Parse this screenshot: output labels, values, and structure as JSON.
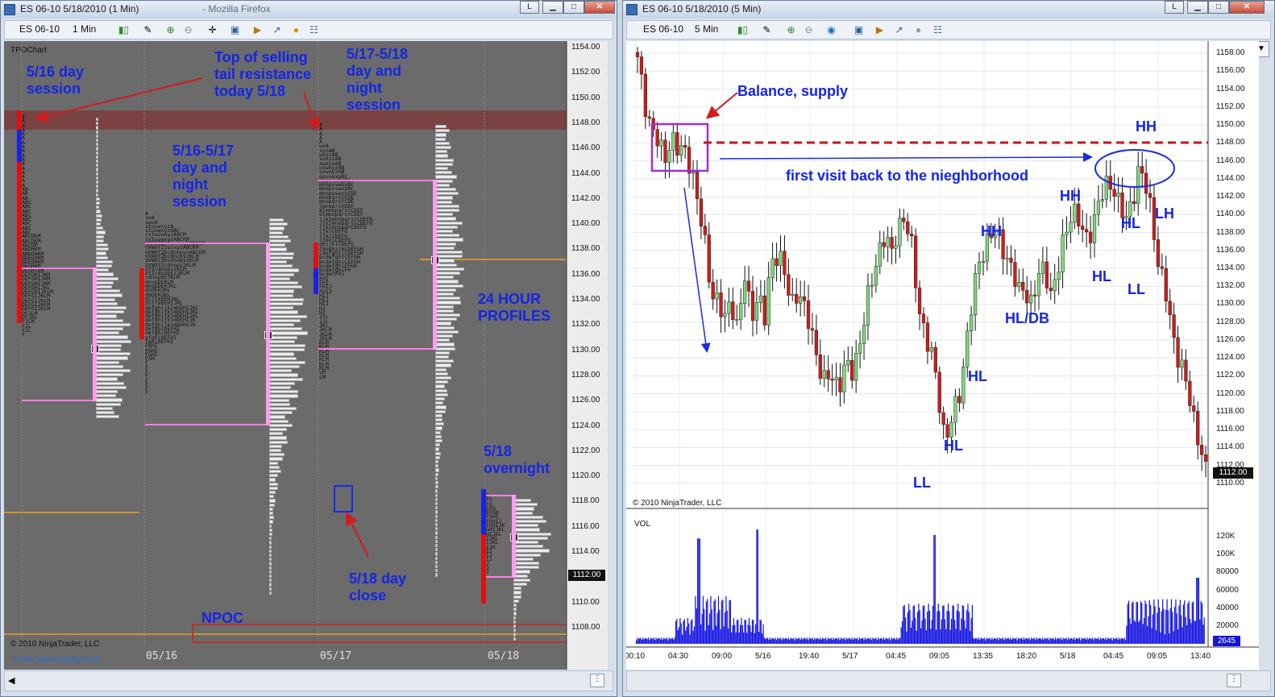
{
  "left_window": {
    "title": "ES 06-10  5/18/2010 (1 Min)",
    "title_suffix": "- Mozilla Firefox",
    "toolbar": {
      "instrument": "ES 06-10",
      "interval": "1 Min"
    },
    "chart_label": "TPOChart",
    "price_axis": [
      "1154.00",
      "1152.00",
      "1150.00",
      "1148.00",
      "1146.00",
      "1144.00",
      "1142.00",
      "1140.00",
      "1138.00",
      "1136.00",
      "1134.00",
      "1132.00",
      "1130.00",
      "1128.00",
      "1126.00",
      "1124.00",
      "1122.00",
      "1120.00",
      "1118.00",
      "1116.00",
      "1114.00",
      "1112.00",
      "1110.00",
      "1108.00"
    ],
    "current_price": "1112.00",
    "date_labels": [
      "05/16",
      "05/17",
      "05/18"
    ],
    "copyright": "© 2010 NinjaTrader, LLC",
    "watermark": "Email: www.tradegr.com",
    "annotations": {
      "day_session": "5/16 day\nsession",
      "selling_tail": "Top of selling\ntail resistance\ntoday 5/18",
      "session_517_518": "5/17-5/18\nday and\nnight\nsession",
      "session_516_517": "5/16-5/17\nday and\nnight\nsession",
      "profiles_24h": "24 HOUR\nPROFILES",
      "overnight": "5/18\novernight",
      "day_close": "5/18 day\nclose",
      "npoc": "NPOC"
    }
  },
  "right_window": {
    "title": "ES 06-10  5/18/2010 (5 Min)",
    "toolbar": {
      "instrument": "ES 06-10",
      "interval": "5 Min"
    },
    "price_axis": [
      "1158.00",
      "1156.00",
      "1154.00",
      "1152.00",
      "1150.00",
      "1148.00",
      "1146.00",
      "1144.00",
      "1142.00",
      "1140.00",
      "1138.00",
      "1136.00",
      "1134.00",
      "1132.00",
      "1130.00",
      "1128.00",
      "1126.00",
      "1124.00",
      "1122.00",
      "1120.00",
      "1118.00",
      "1116.00",
      "1114.00",
      "1112.00",
      "1110.00"
    ],
    "current_price": "1112.00",
    "copyright": "© 2010 NinjaTrader, LLC",
    "vol_label": "VOL",
    "vol_axis": [
      "120K",
      "100K",
      "80000",
      "60000",
      "40000",
      "20000"
    ],
    "vol_current": "2645",
    "time_labels": [
      "00:10",
      "04:30",
      "09:00",
      "5/16",
      "19:40",
      "5/17",
      "04:45",
      "09:05",
      "13:35",
      "18:20",
      "5/18",
      "04:45",
      "09:05",
      "13:40"
    ],
    "annotations": {
      "balance": "Balance, supply",
      "first_visit": "first visit back to the nieghborhood",
      "labels": [
        "HH",
        "HH",
        "HH",
        "HL",
        "HL",
        "HL",
        "LH",
        "HL",
        "LL",
        "HL/DB",
        "HL",
        "HL",
        "LL"
      ]
    }
  },
  "chart_data": {
    "type": "candlestick",
    "title": "ES 06-10 5/18/2010 (5 Min)",
    "ylim": [
      1109,
      1159
    ],
    "points_y": [
      1157,
      1153,
      1150,
      1148,
      1146,
      1149,
      1147,
      1147,
      1146,
      1141,
      1137,
      1132,
      1130,
      1128,
      1131,
      1127,
      1133,
      1129,
      1131,
      1128,
      1135,
      1136,
      1133,
      1130,
      1132,
      1129,
      1127,
      1124,
      1121,
      1122,
      1121,
      1123,
      1122,
      1125,
      1129,
      1132,
      1136,
      1138,
      1135,
      1139,
      1140,
      1136,
      1130,
      1127,
      1124,
      1120,
      1115,
      1117,
      1119,
      1125,
      1130,
      1134,
      1137,
      1138,
      1137,
      1136,
      1134,
      1131,
      1132,
      1130,
      1133,
      1134,
      1131,
      1134,
      1138,
      1141,
      1139,
      1137,
      1139,
      1141,
      1143,
      1144,
      1141,
      1139,
      1142,
      1145,
      1143,
      1140,
      1134,
      1131,
      1127,
      1124,
      1121,
      1118,
      1115,
      1111
    ]
  }
}
